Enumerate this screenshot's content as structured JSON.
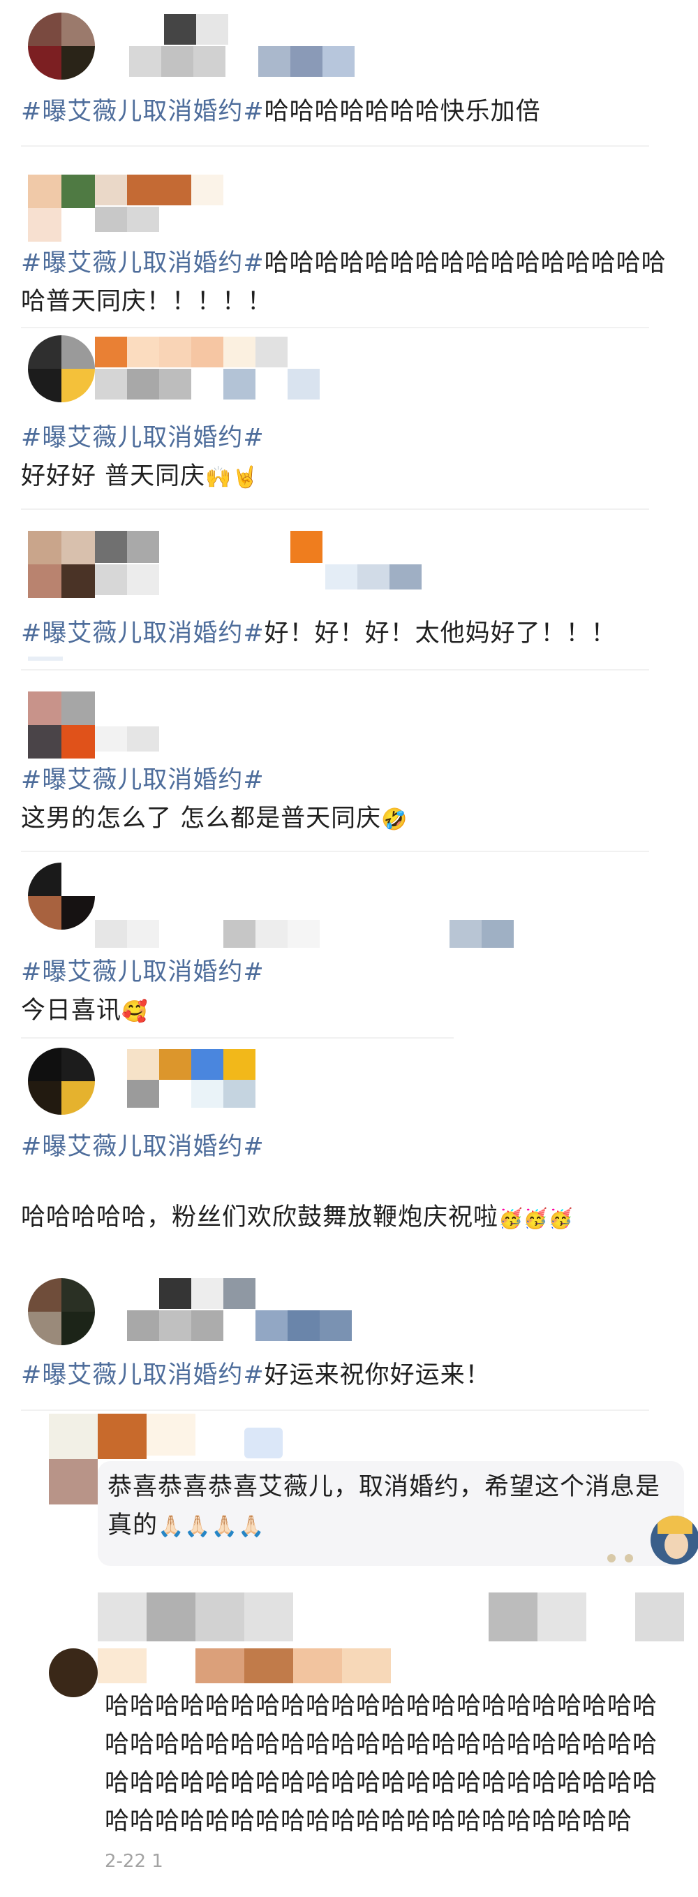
{
  "posts": [
    {
      "hashtag": "#曝艾薇儿取消婚约#",
      "body": "哈哈哈哈哈哈哈快乐加倍"
    },
    {
      "hashtag": "#曝艾薇儿取消婚约#",
      "body": "哈哈哈哈哈哈哈哈哈哈哈哈哈哈哈哈哈普天同庆！！！！！"
    },
    {
      "hashtag": "#曝艾薇儿取消婚约#",
      "body": "好好好 普天同庆"
    },
    {
      "hashtag": "#曝艾薇儿取消婚约#",
      "body": "好！好！好！太他妈好了！！！"
    },
    {
      "hashtag": "#曝艾薇儿取消婚约#",
      "body": "这男的怎么了 怎么都是普天同庆"
    },
    {
      "hashtag": "#曝艾薇儿取消婚约#",
      "body": "今日喜讯"
    },
    {
      "hashtag": "#曝艾薇儿取消婚约#",
      "body": "哈哈哈哈哈，粉丝们欢欣鼓舞放鞭炮庆祝啦"
    },
    {
      "hashtag": "#曝艾薇儿取消婚约#",
      "body": "好运来祝你好运来！"
    }
  ],
  "replies": [
    {
      "body": "恭喜恭喜恭喜艾薇儿，取消婚约，希望这个消息是真的",
      "emoji": "🙏🏻🙏🏻🙏🏻🙏🏻"
    },
    {
      "body": "哈哈哈哈哈哈哈哈哈哈哈哈哈哈哈哈哈哈哈哈哈哈哈哈哈哈哈哈哈哈哈哈哈哈哈哈哈哈哈哈哈哈哈哈哈哈哈哈哈哈哈哈哈哈哈哈哈哈哈哈哈哈哈哈哈哈哈哈哈哈哈哈哈哈哈哈哈哈哈哈哈哈哈哈哈哈哈"
    }
  ],
  "timestamp": "2-22 1",
  "emojis": {
    "post3": "🙌🤘",
    "post5": "🤣",
    "post6": "🥰",
    "post7": "🥳🥳🥳"
  },
  "colors": {
    "hashtag": "#4e6d9b",
    "text": "#1f1f1f",
    "divider": "#f1f1f1",
    "bubble": "#f5f5f7"
  }
}
